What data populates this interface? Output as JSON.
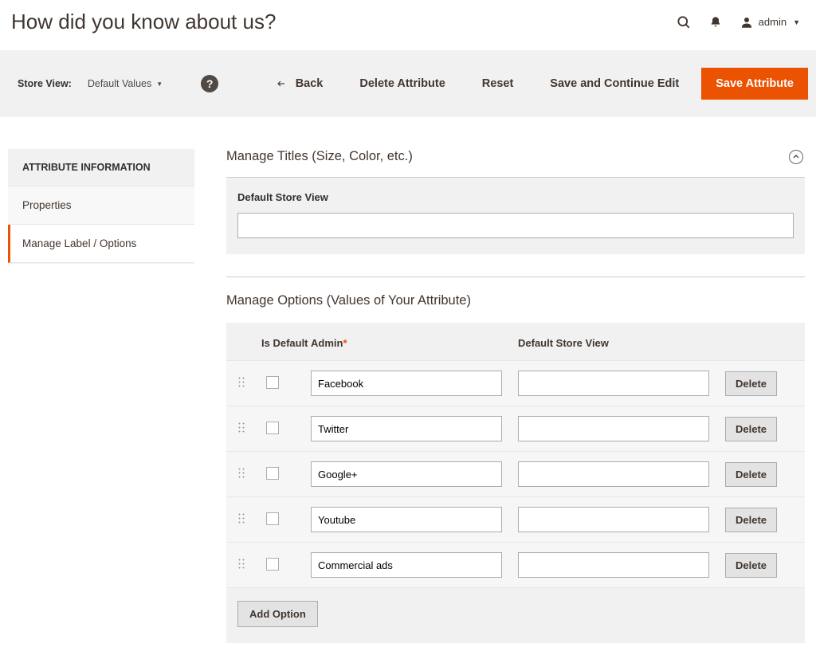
{
  "header": {
    "page_title": "How did you know about us?",
    "user_label": "admin"
  },
  "action_bar": {
    "store_view_label": "Store View:",
    "store_view_value": "Default Values",
    "back": "Back",
    "delete": "Delete Attribute",
    "reset": "Reset",
    "save_continue": "Save and Continue Edit",
    "save": "Save Attribute"
  },
  "sidebar": {
    "title": "ATTRIBUTE INFORMATION",
    "items": [
      {
        "label": "Properties",
        "active": false
      },
      {
        "label": "Manage Label / Options",
        "active": true
      }
    ]
  },
  "manage_titles": {
    "section_title": "Manage Titles (Size, Color, etc.)",
    "default_store_view_label": "Default Store View",
    "default_store_view_value": ""
  },
  "manage_options": {
    "section_title": "Manage Options (Values of Your Attribute)",
    "columns": {
      "is_default": "Is Default",
      "admin": "Admin",
      "default_store_view": "Default Store View"
    },
    "rows": [
      {
        "admin": "Facebook",
        "store": "",
        "is_default": false
      },
      {
        "admin": "Twitter",
        "store": "",
        "is_default": false
      },
      {
        "admin": "Google+",
        "store": "",
        "is_default": false
      },
      {
        "admin": "Youtube",
        "store": "",
        "is_default": false
      },
      {
        "admin": "Commercial ads",
        "store": "",
        "is_default": false
      }
    ],
    "delete_label": "Delete",
    "add_option_label": "Add Option"
  }
}
